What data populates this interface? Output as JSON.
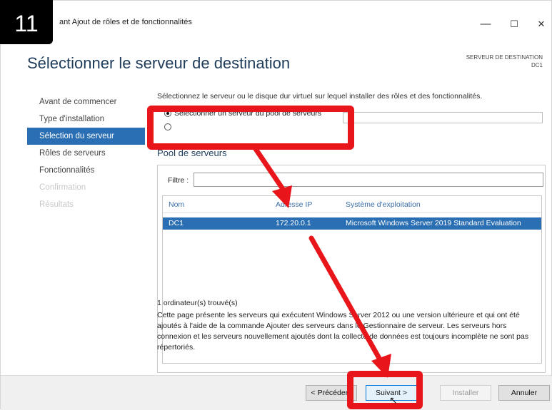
{
  "step_number": "11",
  "window": {
    "title": "ant Ajout de rôles et de fonctionnalités",
    "controls": {
      "minimize": "—",
      "maximize": "☐",
      "close": "✕"
    }
  },
  "page": {
    "title": "Sélectionner le serveur de destination",
    "destination_label": "SERVEUR DE DESTINATION",
    "destination_value": "DC1"
  },
  "nav": {
    "items": [
      {
        "label": "Avant de commencer",
        "state": "normal"
      },
      {
        "label": "Type d'installation",
        "state": "normal"
      },
      {
        "label": "Sélection du serveur",
        "state": "active"
      },
      {
        "label": "Rôles de serveurs",
        "state": "normal"
      },
      {
        "label": "Fonctionnalités",
        "state": "normal"
      },
      {
        "label": "Confirmation",
        "state": "disabled"
      },
      {
        "label": "Résultats",
        "state": "disabled"
      }
    ]
  },
  "content": {
    "intro": "Sélectionnez le serveur ou le disque dur virtuel sur lequel installer des rôles et des fonctionnalités.",
    "option_pool": "Sélectionner un serveur du pool de serveurs",
    "pool_title": "Pool de serveurs",
    "filter_label": "Filtre :",
    "filter_value": "",
    "columns": [
      "Nom",
      "Adresse IP",
      "Système d'exploitation"
    ],
    "rows": [
      {
        "name": "DC1",
        "ip": "172.20.0.1",
        "os": "Microsoft Windows Server 2019 Standard Evaluation"
      }
    ],
    "found": "1 ordinateur(s) trouvé(s)",
    "description": "Cette page présente les serveurs qui exécutent Windows Server 2012 ou une version ultérieure et qui ont été ajoutés à l'aide de la commande Ajouter des serveurs dans le Gestionnaire de serveur. Les serveurs hors connexion et les serveurs nouvellement ajoutés dont la collecte de données est toujours incomplète ne sont pas répertoriés."
  },
  "footer": {
    "previous": "< Précédent",
    "next": "Suivant >",
    "install": "Installer",
    "cancel": "Annuler"
  },
  "colors": {
    "accent": "#2a6eb4",
    "highlight": "#e8161b",
    "badge": "#000000"
  }
}
